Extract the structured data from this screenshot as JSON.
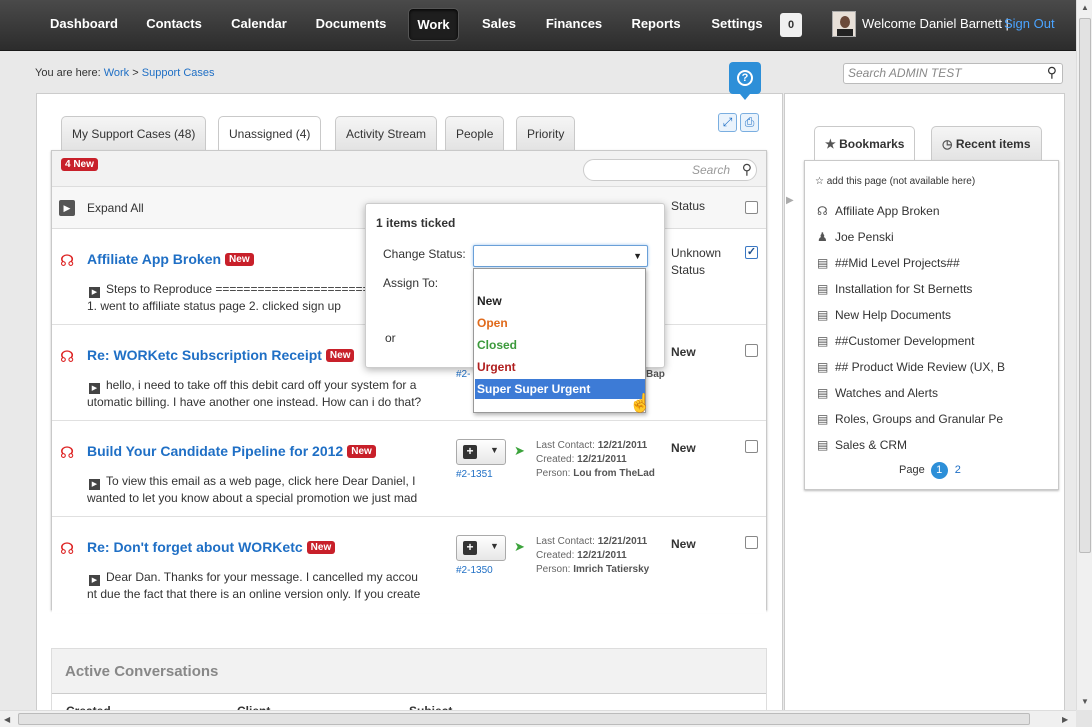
{
  "nav": {
    "items": [
      "Dashboard",
      "Contacts",
      "Calendar",
      "Documents",
      "Work",
      "Sales",
      "Finances",
      "Reports",
      "Settings"
    ],
    "active": "Work",
    "notifications": "0",
    "welcome": "Welcome Daniel Barnett |",
    "signout": "Sign Out"
  },
  "breadcrumb": {
    "prefix": "You are here:",
    "link1": "Work",
    "sep": ">",
    "link2": "Support Cases"
  },
  "help_icon": "?",
  "admin_search": {
    "placeholder": "Search ADMIN TEST"
  },
  "tabs": [
    "My Support Cases (48)",
    "Unassigned (4)",
    "Activity Stream",
    "People",
    "Priority"
  ],
  "active_tab": "Unassigned (4)",
  "list": {
    "new_badge": "4 New",
    "search_placeholder": "Search",
    "expand_all": "Expand All",
    "status_header": "Status",
    "rows": [
      {
        "title": "Affiliate App Broken",
        "badge": "New",
        "line1": "Steps to Reproduce ============================",
        "line2": "1. went to affiliate status page 2. clicked sign up",
        "status1": "Unknown",
        "status2": "Status",
        "checked": true
      },
      {
        "title": "Re: WORKetc Subscription Receipt",
        "badge": "New",
        "line1": "hello, i need to take off this debit card off your system for a",
        "line2": "utomatic billing. I have another one instead. How can i do that?",
        "ref": "#2-",
        "person_tail": "Bap",
        "status1": "New",
        "checked": false
      },
      {
        "title": "Build Your Candidate Pipeline for 2012",
        "badge": "New",
        "line1": "To view this email as a web page, click here Dear Daniel, I",
        "line2": "wanted to let you know about a special promotion we just mad",
        "ref": "#2-1351",
        "last_contact_label": "Last Contact:",
        "last_contact": "12/21/2011",
        "created_label": "Created:",
        "created": "12/21/2011",
        "person_label": "Person:",
        "person": "Lou from TheLad",
        "status1": "New",
        "checked": false
      },
      {
        "title": "Re: Don't forget about WORKetc",
        "badge": "New",
        "line1": "Dear Dan. Thanks for your message. I cancelled my accou",
        "line2": "nt due the fact that there is an online version only. If you create",
        "ref": "#2-1350",
        "last_contact_label": "Last Contact:",
        "last_contact": "12/21/2011",
        "created_label": "Created:",
        "created": "12/21/2011",
        "person_label": "Person:",
        "person": "Imrich Tatiersky",
        "status1": "New",
        "checked": false
      }
    ]
  },
  "popup": {
    "title": "1 items ticked",
    "change_status": "Change Status:",
    "assign_to": "Assign To:",
    "or": "or",
    "options": [
      {
        "label": "New",
        "color": "#222222"
      },
      {
        "label": "Open",
        "color": "#e06a1b"
      },
      {
        "label": "Closed",
        "color": "#3c9a3c"
      },
      {
        "label": "Urgent",
        "color": "#b01e1e"
      },
      {
        "label": "Super Super Urgent",
        "color": "#ffffff"
      }
    ],
    "selected": "Super Super Urgent"
  },
  "active_conversations": {
    "title": "Active Conversations",
    "columns": [
      "Created",
      "Client",
      "Subject"
    ]
  },
  "bookmarks": {
    "tab_bookmarks": "Bookmarks",
    "tab_recent": "Recent items",
    "add_page": "add this page (not available here)",
    "items": [
      {
        "icon": "headset-icon",
        "label": "Affiliate App Broken"
      },
      {
        "icon": "person-icon",
        "label": "Joe Penski"
      },
      {
        "icon": "project-icon",
        "label": "##Mid Level Projects##"
      },
      {
        "icon": "project-icon",
        "label": "Installation for St Bernetts"
      },
      {
        "icon": "project-icon",
        "label": "New Help Documents"
      },
      {
        "icon": "project-icon",
        "label": "##Customer Development"
      },
      {
        "icon": "project-icon",
        "label": "## Product Wide Review (UX, B"
      },
      {
        "icon": "project-icon",
        "label": "Watches and Alerts"
      },
      {
        "icon": "project-icon",
        "label": "Roles, Groups and Granular Pe"
      },
      {
        "icon": "project-icon",
        "label": "Sales & CRM"
      }
    ],
    "page_label": "Page",
    "pages": [
      "1",
      "2"
    ],
    "current_page": "1"
  },
  "colors": {
    "nav_bg": "#333333",
    "accent": "#2d8fd8",
    "badge_red": "#c8202a",
    "link": "#1f6fc5"
  }
}
